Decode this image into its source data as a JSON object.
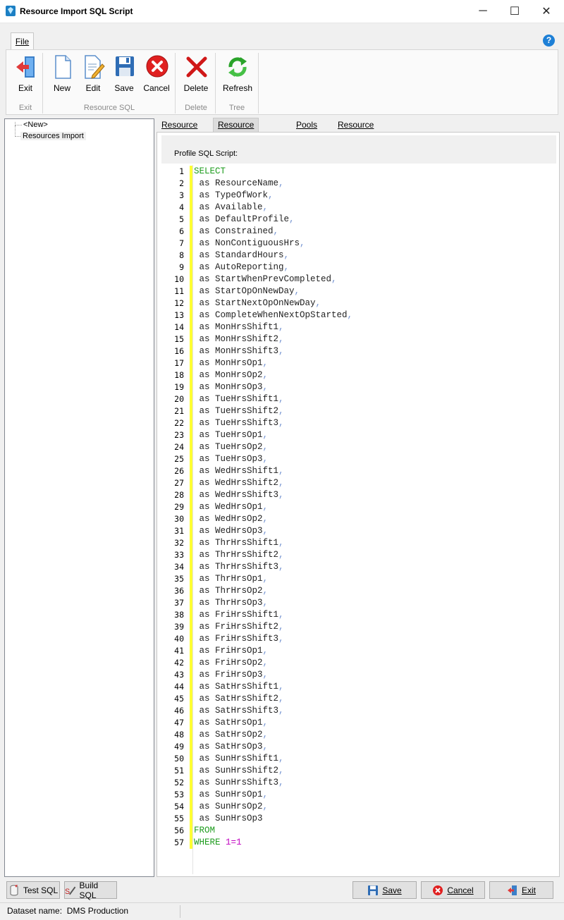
{
  "window": {
    "title": "Resource Import SQL Script",
    "minimize_glyph": "─",
    "maximize_glyph": "☐",
    "close_glyph": "✕"
  },
  "ribbon": {
    "file_tab": "File",
    "help_glyph": "?",
    "groups": {
      "exit": "Exit",
      "resource_sql": "Resource SQL",
      "delete": "Delete",
      "tree": "Tree"
    },
    "buttons": {
      "exit": "Exit",
      "new": "New",
      "edit": "Edit",
      "save": "Save",
      "cancel": "Cancel",
      "delete": "Delete",
      "refresh": "Refresh"
    }
  },
  "tree": {
    "items": [
      "<New>",
      "Resources Import"
    ]
  },
  "tabs": [
    "Resource SQL",
    "Resource Profile SQL",
    "Pools SQL",
    "Resource Pools SQL"
  ],
  "active_tab": "Resource Profile SQL",
  "profile": {
    "label": "Profile SQL Script:"
  },
  "sql_lines": [
    "SELECT",
    " as ResourceName,",
    " as TypeOfWork,",
    " as Available,",
    " as DefaultProfile,",
    " as Constrained,",
    " as NonContiguousHrs,",
    " as StandardHours,",
    " as AutoReporting,",
    " as StartWhenPrevCompleted,",
    " as StartOpOnNewDay,",
    " as StartNextOpOnNewDay,",
    " as CompleteWhenNextOpStarted,",
    " as MonHrsShift1,",
    " as MonHrsShift2,",
    " as MonHrsShift3,",
    " as MonHrsOp1,",
    " as MonHrsOp2,",
    " as MonHrsOp3,",
    " as TueHrsShift1,",
    " as TueHrsShift2,",
    " as TueHrsShift3,",
    " as TueHrsOp1,",
    " as TueHrsOp2,",
    " as TueHrsOp3,",
    " as WedHrsShift1,",
    " as WedHrsShift2,",
    " as WedHrsShift3,",
    " as WedHrsOp1,",
    " as WedHrsOp2,",
    " as WedHrsOp3,",
    " as ThrHrsShift1,",
    " as ThrHrsShift2,",
    " as ThrHrsShift3,",
    " as ThrHrsOp1,",
    " as ThrHrsOp2,",
    " as ThrHrsOp3,",
    " as FriHrsShift1,",
    " as FriHrsShift2,",
    " as FriHrsShift3,",
    " as FriHrsOp1,",
    " as FriHrsOp2,",
    " as FriHrsOp3,",
    " as SatHrsShift1,",
    " as SatHrsShift2,",
    " as SatHrsShift3,",
    " as SatHrsOp1,",
    " as SatHrsOp2,",
    " as SatHrsOp3,",
    " as SunHrsShift1,",
    " as SunHrsShift2,",
    " as SunHrsShift3,",
    " as SunHrsOp1,",
    " as SunHrsOp2,",
    " as SunHrsOp3",
    "FROM",
    "WHERE 1=1"
  ],
  "bottom": {
    "test_sql": "Test SQL",
    "build_sql": "Build SQL",
    "save": "Save",
    "cancel": "Cancel",
    "exit": "Exit"
  },
  "status": {
    "text": "Dataset name:  DMS Production"
  },
  "colors": {
    "keyword": "#1e9c1e",
    "comma": "#7090d0",
    "number": "#c000c0",
    "change_bar": "#ffff33"
  }
}
